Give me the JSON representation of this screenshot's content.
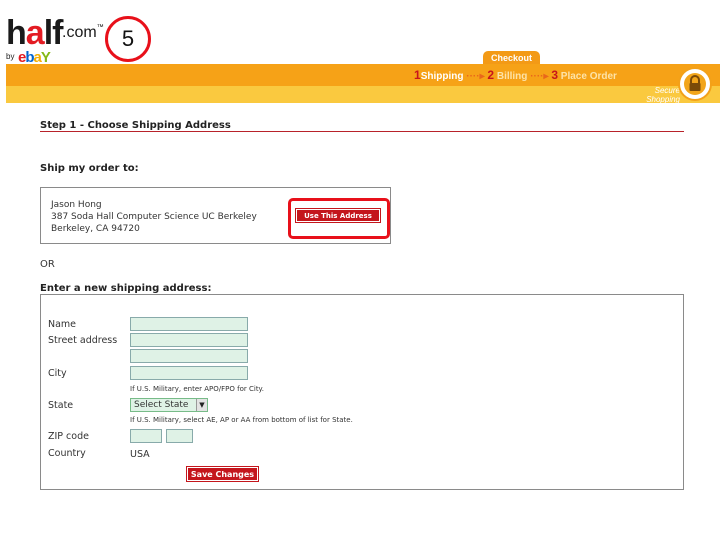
{
  "logo": {
    "half": "half",
    "half_a": "a",
    "half_rest": "lf",
    "com": ".com",
    "tm": "™",
    "by": "by",
    "ebay": [
      "e",
      "b",
      "a",
      "Y"
    ]
  },
  "annotation": {
    "step_number": "5"
  },
  "checkout": {
    "tab_label": "Checkout",
    "steps": [
      {
        "num": "1",
        "label": "Shipping"
      },
      {
        "num": "2",
        "label": "Billing"
      },
      {
        "num": "3",
        "label": "Place Order"
      }
    ],
    "arrow": "····▸",
    "secure_line1": "Secure",
    "secure_line2": "Shopping"
  },
  "step_title": "Step 1 - Choose Shipping Address",
  "ship_to_label": "Ship my order to:",
  "saved_address": {
    "lines": [
      "Jason Hong",
      "387 Soda Hall Computer Science UC Berkeley",
      "Berkeley, CA 94720"
    ],
    "button_label": "Use This Address"
  },
  "or_label": "OR",
  "new_address": {
    "heading": "Enter a new shipping address:",
    "name_label": "Name",
    "street_label": "Street address",
    "city_label": "City",
    "city_hint": "If U.S. Military, enter APO/FPO for City.",
    "state_label": "State",
    "state_value": "Select State",
    "state_hint": "If U.S. Military, select AE, AP or AA from bottom of list for State.",
    "zip_label": "ZIP code",
    "country_label": "Country",
    "country_value": "USA",
    "save_label": "Save Changes"
  },
  "colors": {
    "brand_orange": "#f6a217",
    "brand_yellow": "#fac93f",
    "button_red": "#c4161c",
    "input_green": "#dff2e6"
  }
}
